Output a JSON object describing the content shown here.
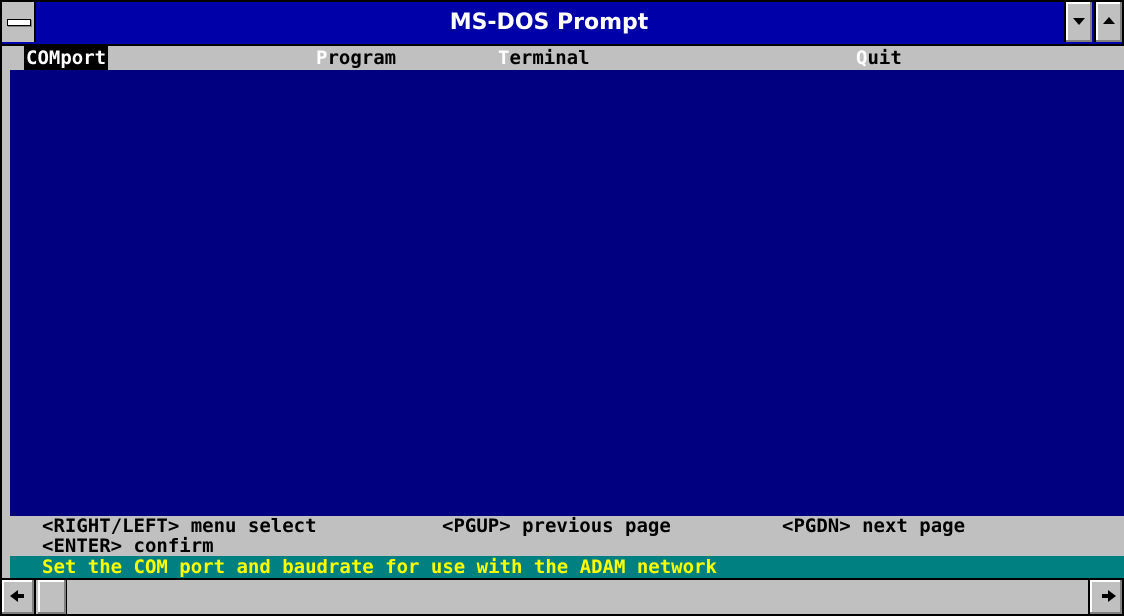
{
  "window": {
    "title": "MS-DOS Prompt"
  },
  "menu": {
    "items": [
      {
        "hot": "",
        "rest": "COMport"
      },
      {
        "hot": "P",
        "rest": "rogram"
      },
      {
        "hot": "T",
        "rest": "erminal"
      },
      {
        "hot": "Q",
        "rest": "uit"
      }
    ]
  },
  "help": {
    "line1_a": "<RIGHT/LEFT> menu select",
    "line1_b": "<PGUP> previous page",
    "line1_c": "<PGDN> next page",
    "line2": "<ENTER> confirm"
  },
  "status": {
    "text": "Set the COM port and baudrate for use with the ADAM network"
  },
  "colors": {
    "title_bar": "#0000a8",
    "screen_bg": "#000080",
    "status_bg": "#008080",
    "status_text": "#ffff00"
  }
}
